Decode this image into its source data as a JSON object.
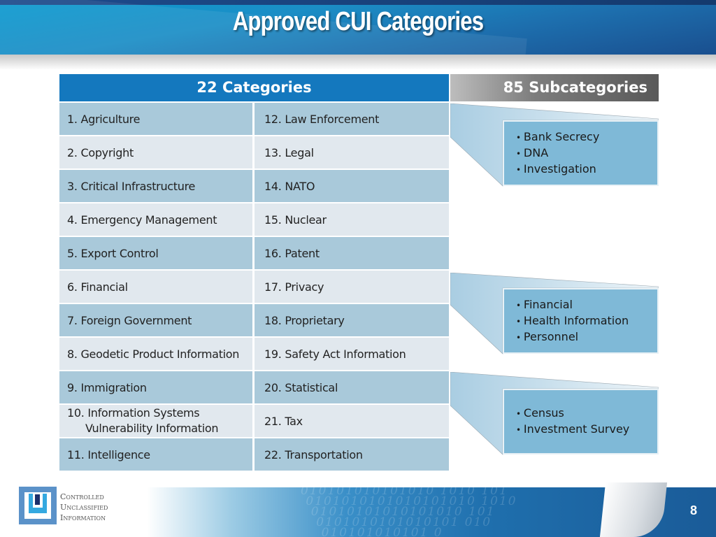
{
  "header": {
    "title": "Approved CUI Categories"
  },
  "categories": {
    "heading": "22 Categories",
    "rows": [
      {
        "left": "1. Agriculture",
        "right": "12. Law Enforcement"
      },
      {
        "left": "2. Copyright",
        "right": "13. Legal"
      },
      {
        "left": "3. Critical Infrastructure",
        "right": "14. NATO"
      },
      {
        "left": "4. Emergency Management",
        "right": "15. Nuclear"
      },
      {
        "left": "5. Export Control",
        "right": "16. Patent"
      },
      {
        "left": "6. Financial",
        "right": "17. Privacy"
      },
      {
        "left": "7. Foreign Government",
        "right": "18. Proprietary"
      },
      {
        "left": "8. Geodetic Product Information",
        "right": "19. Safety Act Information"
      },
      {
        "left": "9. Immigration",
        "right": "20. Statistical"
      },
      {
        "left": "10. Information Systems",
        "left_line2": "Vulnerability Information",
        "right": "21. Tax"
      },
      {
        "left": "11. Intelligence",
        "right": "22. Transportation"
      }
    ]
  },
  "subcategories": {
    "heading": "85 Subcategories",
    "callouts": [
      {
        "items": [
          "Bank Secrecy",
          "DNA",
          "Investigation"
        ]
      },
      {
        "items": [
          "Financial",
          "Health Information",
          "Personnel"
        ]
      },
      {
        "items": [
          "Census",
          "Investment Survey"
        ]
      }
    ]
  },
  "footer": {
    "logo_lines": [
      "Controlled",
      "Unclassified",
      "Information"
    ],
    "page_number": "8"
  },
  "colors": {
    "header_blue": "#1478be",
    "row_dark": "#a9c9da",
    "row_light": "#e1e8ee",
    "callout_blue": "#7fb9d7"
  }
}
